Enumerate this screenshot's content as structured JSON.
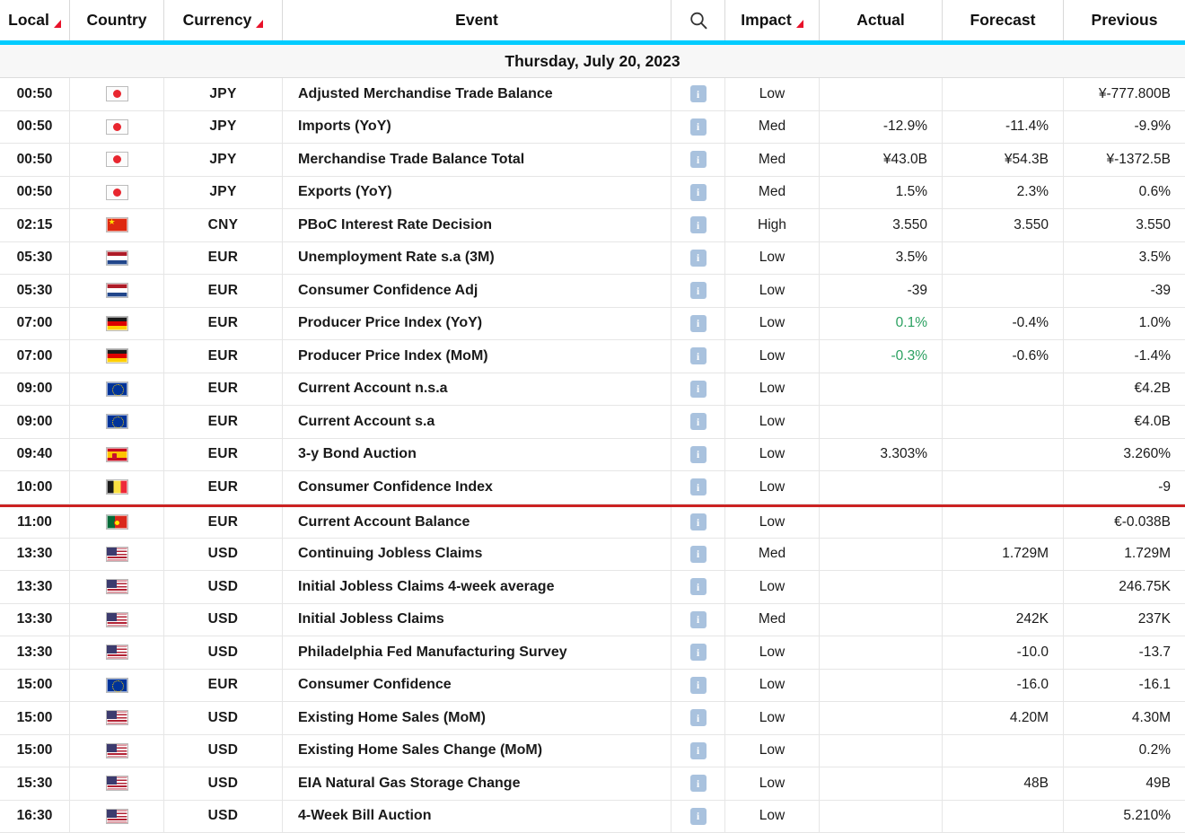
{
  "header": {
    "columns": [
      {
        "label": "Local",
        "sortable": true,
        "icon": null
      },
      {
        "label": "Country",
        "sortable": false,
        "icon": null
      },
      {
        "label": "Currency",
        "sortable": true,
        "icon": null
      },
      {
        "label": "Event",
        "sortable": false,
        "icon": null
      },
      {
        "label": "",
        "sortable": false,
        "icon": "search-icon"
      },
      {
        "label": "Impact",
        "sortable": true,
        "icon": null
      },
      {
        "label": "Actual",
        "sortable": false,
        "icon": null
      },
      {
        "label": "Forecast",
        "sortable": false,
        "icon": null
      },
      {
        "label": "Previous",
        "sortable": false,
        "icon": null
      }
    ],
    "accent_color": "#00ccff",
    "sort_arrow_color": "#e8122a"
  },
  "date_band": {
    "label": "Thursday, July 20, 2023"
  },
  "now_marker": {
    "color": "#cc2222",
    "after_row_index": 12
  },
  "info_icon": {
    "glyph": "i",
    "color": "#a9c2de",
    "name": "info-icon"
  },
  "rows": [
    {
      "time": "00:50",
      "flag": "jp",
      "country": "Japan",
      "currency": "JPY",
      "event": "Adjusted Merchandise Trade Balance",
      "impact": "Low",
      "actual": "",
      "forecast": "",
      "previous": "¥-777.800B",
      "actual_state": "none"
    },
    {
      "time": "00:50",
      "flag": "jp",
      "country": "Japan",
      "currency": "JPY",
      "event": "Imports (YoY)",
      "impact": "Med",
      "actual": "-12.9%",
      "forecast": "-11.4%",
      "previous": "-9.9%",
      "actual_state": "none"
    },
    {
      "time": "00:50",
      "flag": "jp",
      "country": "Japan",
      "currency": "JPY",
      "event": "Merchandise Trade Balance Total",
      "impact": "Med",
      "actual": "¥43.0B",
      "forecast": "¥54.3B",
      "previous": "¥-1372.5B",
      "actual_state": "none"
    },
    {
      "time": "00:50",
      "flag": "jp",
      "country": "Japan",
      "currency": "JPY",
      "event": "Exports (YoY)",
      "impact": "Med",
      "actual": "1.5%",
      "forecast": "2.3%",
      "previous": "0.6%",
      "actual_state": "none"
    },
    {
      "time": "02:15",
      "flag": "cn",
      "country": "China",
      "currency": "CNY",
      "event": "PBoC Interest Rate Decision",
      "impact": "High",
      "actual": "3.550",
      "forecast": "3.550",
      "previous": "3.550",
      "actual_state": "none"
    },
    {
      "time": "05:30",
      "flag": "nl",
      "country": "Netherlands",
      "currency": "EUR",
      "event": "Unemployment Rate s.a (3M)",
      "impact": "Low",
      "actual": "3.5%",
      "forecast": "",
      "previous": "3.5%",
      "actual_state": "none"
    },
    {
      "time": "05:30",
      "flag": "nl",
      "country": "Netherlands",
      "currency": "EUR",
      "event": "Consumer Confidence Adj",
      "impact": "Low",
      "actual": "-39",
      "forecast": "",
      "previous": "-39",
      "actual_state": "none"
    },
    {
      "time": "07:00",
      "flag": "de",
      "country": "Germany",
      "currency": "EUR",
      "event": "Producer Price Index (YoY)",
      "impact": "Low",
      "actual": "0.1%",
      "forecast": "-0.4%",
      "previous": "1.0%",
      "actual_state": "positive"
    },
    {
      "time": "07:00",
      "flag": "de",
      "country": "Germany",
      "currency": "EUR",
      "event": "Producer Price Index (MoM)",
      "impact": "Low",
      "actual": "-0.3%",
      "forecast": "-0.6%",
      "previous": "-1.4%",
      "actual_state": "positive"
    },
    {
      "time": "09:00",
      "flag": "eu",
      "country": "European Union",
      "currency": "EUR",
      "event": "Current Account n.s.a",
      "impact": "Low",
      "actual": "",
      "forecast": "",
      "previous": "€4.2B",
      "actual_state": "none"
    },
    {
      "time": "09:00",
      "flag": "eu",
      "country": "European Union",
      "currency": "EUR",
      "event": "Current Account s.a",
      "impact": "Low",
      "actual": "",
      "forecast": "",
      "previous": "€4.0B",
      "actual_state": "none"
    },
    {
      "time": "09:40",
      "flag": "es",
      "country": "Spain",
      "currency": "EUR",
      "event": "3-y Bond Auction",
      "impact": "Low",
      "actual": "3.303%",
      "forecast": "",
      "previous": "3.260%",
      "actual_state": "none"
    },
    {
      "time": "10:00",
      "flag": "be",
      "country": "Belgium",
      "currency": "EUR",
      "event": "Consumer Confidence Index",
      "impact": "Low",
      "actual": "",
      "forecast": "",
      "previous": "-9",
      "actual_state": "none"
    },
    {
      "time": "11:00",
      "flag": "pt",
      "country": "Portugal",
      "currency": "EUR",
      "event": "Current Account Balance",
      "impact": "Low",
      "actual": "",
      "forecast": "",
      "previous": "€-0.038B",
      "actual_state": "none"
    },
    {
      "time": "13:30",
      "flag": "us",
      "country": "United States",
      "currency": "USD",
      "event": "Continuing Jobless Claims",
      "impact": "Med",
      "actual": "",
      "forecast": "1.729M",
      "previous": "1.729M",
      "actual_state": "none"
    },
    {
      "time": "13:30",
      "flag": "us",
      "country": "United States",
      "currency": "USD",
      "event": "Initial Jobless Claims 4-week average",
      "impact": "Low",
      "actual": "",
      "forecast": "",
      "previous": "246.75K",
      "actual_state": "none"
    },
    {
      "time": "13:30",
      "flag": "us",
      "country": "United States",
      "currency": "USD",
      "event": "Initial Jobless Claims",
      "impact": "Med",
      "actual": "",
      "forecast": "242K",
      "previous": "237K",
      "actual_state": "none"
    },
    {
      "time": "13:30",
      "flag": "us",
      "country": "United States",
      "currency": "USD",
      "event": "Philadelphia Fed Manufacturing Survey",
      "impact": "Low",
      "actual": "",
      "forecast": "-10.0",
      "previous": "-13.7",
      "actual_state": "none"
    },
    {
      "time": "15:00",
      "flag": "eu",
      "country": "European Union",
      "currency": "EUR",
      "event": "Consumer Confidence",
      "impact": "Low",
      "actual": "",
      "forecast": "-16.0",
      "previous": "-16.1",
      "actual_state": "none"
    },
    {
      "time": "15:00",
      "flag": "us",
      "country": "United States",
      "currency": "USD",
      "event": "Existing Home Sales (MoM)",
      "impact": "Low",
      "actual": "",
      "forecast": "4.20M",
      "previous": "4.30M",
      "actual_state": "none"
    },
    {
      "time": "15:00",
      "flag": "us",
      "country": "United States",
      "currency": "USD",
      "event": "Existing Home Sales Change (MoM)",
      "impact": "Low",
      "actual": "",
      "forecast": "",
      "previous": "0.2%",
      "actual_state": "none"
    },
    {
      "time": "15:30",
      "flag": "us",
      "country": "United States",
      "currency": "USD",
      "event": "EIA Natural Gas Storage Change",
      "impact": "Low",
      "actual": "",
      "forecast": "48B",
      "previous": "49B",
      "actual_state": "none"
    },
    {
      "time": "16:30",
      "flag": "us",
      "country": "United States",
      "currency": "USD",
      "event": "4-Week Bill Auction",
      "impact": "Low",
      "actual": "",
      "forecast": "",
      "previous": "5.210%",
      "actual_state": "none"
    }
  ]
}
